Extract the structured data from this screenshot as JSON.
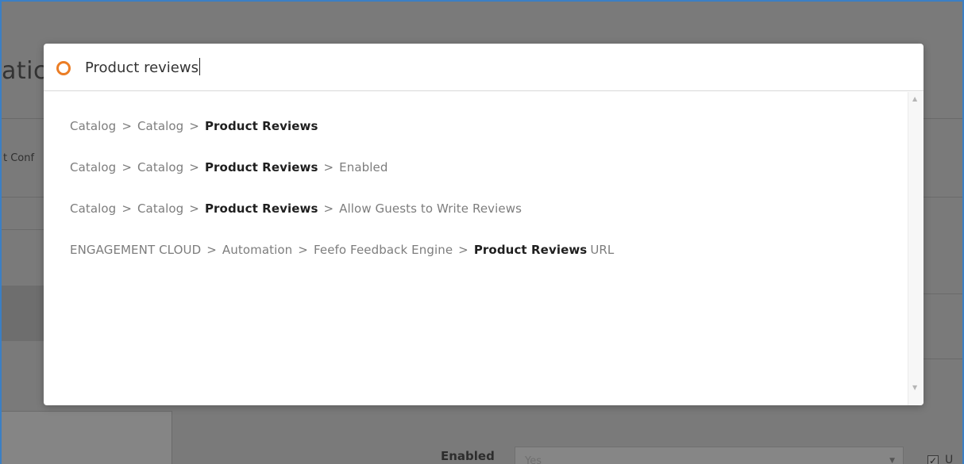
{
  "background": {
    "page_title_fragment": "atic",
    "config_fragment": "t Conf",
    "enabled_label": "Enabled",
    "enabled_value": "Yes",
    "checkbox_label_fragment": "U"
  },
  "search": {
    "query": "Product reviews",
    "icon": "search-ring-icon",
    "accent_color": "#eb7d25"
  },
  "results": [
    {
      "path": [
        "Catalog",
        "Catalog"
      ],
      "highlight": "Product Reviews",
      "suffix_sep": "",
      "suffix": ""
    },
    {
      "path": [
        "Catalog",
        "Catalog"
      ],
      "highlight": "Product Reviews",
      "suffix_sep": ">",
      "suffix": "Enabled"
    },
    {
      "path": [
        "Catalog",
        "Catalog"
      ],
      "highlight": "Product Reviews",
      "suffix_sep": ">",
      "suffix": "Allow Guests to Write Reviews"
    },
    {
      "path": [
        "ENGAGEMENT CLOUD",
        "Automation",
        "Feefo Feedback Engine"
      ],
      "highlight": "Product Reviews",
      "suffix_sep": "",
      "suffix": "URL"
    }
  ],
  "separator": ">"
}
